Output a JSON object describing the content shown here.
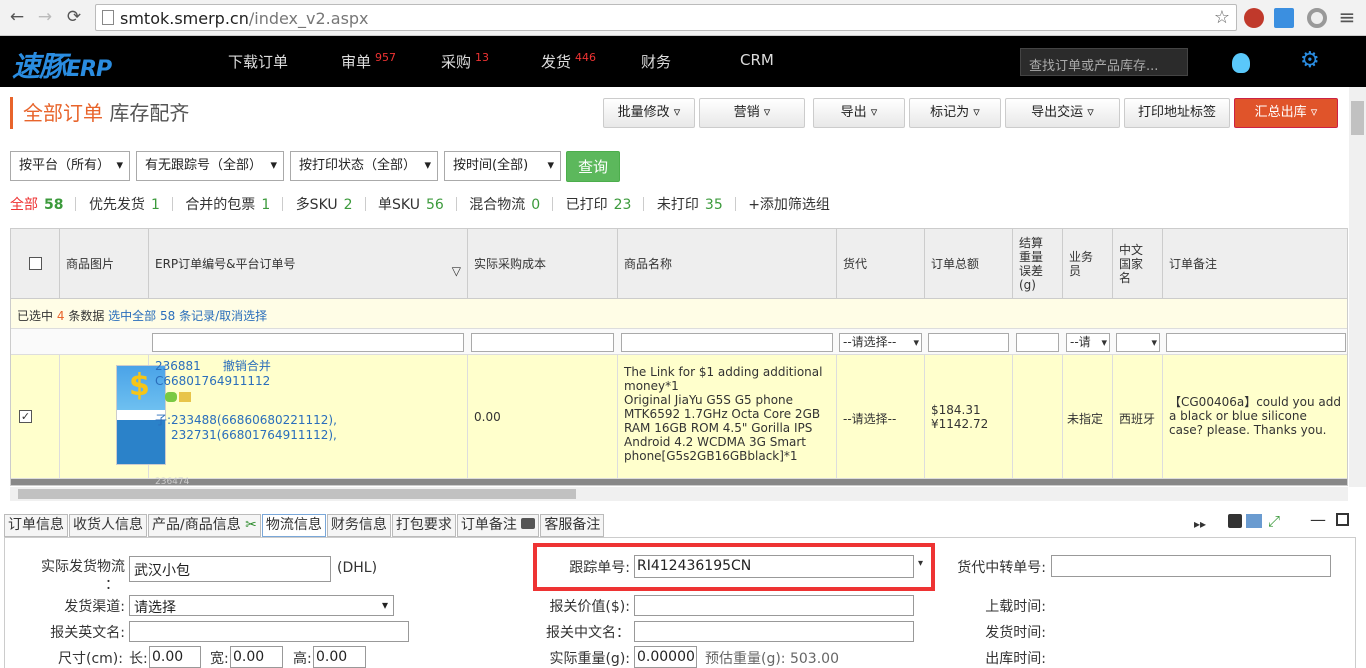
{
  "browser": {
    "url_host": "smtok.smerp.cn",
    "url_path": "/index_v2.aspx"
  },
  "app": {
    "logo": "速豚",
    "logo_suffix": "ERP",
    "search_placeholder": "查找订单或产品库存...",
    "menu": [
      {
        "label": "下载订单",
        "badge": ""
      },
      {
        "label": "审单",
        "badge": "957"
      },
      {
        "label": "采购",
        "badge": "13"
      },
      {
        "label": "发货",
        "badge": "446"
      },
      {
        "label": "财务",
        "badge": ""
      },
      {
        "label": "CRM",
        "badge": ""
      }
    ]
  },
  "page": {
    "title_main": "全部订单",
    "title_sub": "库存配齐",
    "buttons": [
      "批量修改 ▿",
      "营销 ▿",
      "导出 ▿",
      "标记为 ▿",
      "导出交运 ▿",
      "打印地址标签",
      "汇总出库 ▿"
    ]
  },
  "filters": {
    "platform": "按平台（所有）",
    "tracking": "有无跟踪号（全部）",
    "print_status": "按打印状态（全部）",
    "time": "按时间(全部)",
    "query": "查询"
  },
  "tabs": [
    {
      "label": "全部",
      "count": "58"
    },
    {
      "label": "优先发货",
      "count": "1"
    },
    {
      "label": "合并的包票",
      "count": "1"
    },
    {
      "label": "多SKU",
      "count": "2"
    },
    {
      "label": "单SKU",
      "count": "56"
    },
    {
      "label": "混合物流",
      "count": "0"
    },
    {
      "label": "已打印",
      "count": "23"
    },
    {
      "label": "未打印",
      "count": "35"
    }
  ],
  "add_filter": "+添加筛选组",
  "grid": {
    "columns": [
      "商品图片",
      "ERP订单编号&平台订单号",
      "实际采购成本",
      "商品名称",
      "货代",
      "订单总额",
      "结算\n重量\n误差\n(g)",
      "业务\n员",
      "中文\n国家\n名",
      "订单备注"
    ],
    "selbar": {
      "prefix": "已选中",
      "count": "4",
      "suffix": "条数据",
      "select_all": "选中全部",
      "total": "58",
      "tail": "条记录/取消选择"
    },
    "filter_select": "--请选择--",
    "filter_select_short": "--请",
    "row": {
      "erp_id": "236881",
      "merged": "撤销合并",
      "platform_id": "C66801764911112",
      "children": "子:233488(66860680221112),",
      "children2": "232731(66801764911112),",
      "cost": "0.00",
      "product": "The Link for $1 adding additional money*1\nOriginal JiaYu G5S G5 phone MTK6592 1.7GHz Octa Core 2GB RAM 16GB ROM 4.5\" Gorilla IPS Android 4.2 WCDMA 3G Smart phone[G5s2GB16GBblack]*1",
      "forwarder": "--请选择--",
      "total_usd": "$184.31",
      "total_cny": "¥1142.72",
      "salesman": "未指定",
      "country": "西班牙",
      "note": "【CG00406a】could you add a black or blue silicone case? please. Thanks you.",
      "img_text": "$",
      "next_id": "236474"
    }
  },
  "bottom_tabs": [
    "订单信息",
    "收货人信息",
    "产品/商品信息",
    "物流信息",
    "财务信息",
    "打包要求",
    "订单备注",
    "客服备注"
  ],
  "logistics": {
    "actual_label": "实际发货物流",
    "actual_colon": "：",
    "actual_value": "武汉小包",
    "actual_code": "(DHL)",
    "channel_label": "发货渠道:",
    "channel_value": "请选择",
    "en_name_label": "报关英文名:",
    "size_label": "尺寸(cm):",
    "len": "长:",
    "len_v": "0.00",
    "wid": "宽:",
    "wid_v": "0.00",
    "hei": "高:",
    "hei_v": "0.00",
    "tracking_label": "跟踪单号:",
    "tracking_value": "RI412436195CN",
    "declared_label": "报关价值($):",
    "cn_name_label": "报关中文名：",
    "weight_label": "实际重量(g):",
    "weight_value": "0.00000",
    "est_label": "预估重量(g):",
    "est_value": "503.00",
    "transfer_label": "货代中转单号:",
    "upload_label": "上载时间:",
    "ship_label": "发货时间:",
    "out_label": "出库时间:"
  },
  "colors": {
    "accent": "#e8642b",
    "link": "#2a6ebb",
    "green": "#5cb85c",
    "highlight": "#e33333"
  }
}
